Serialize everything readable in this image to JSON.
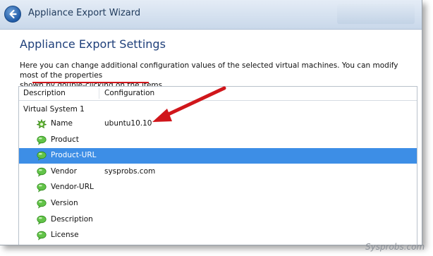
{
  "window": {
    "title": "Appliance Export Wizard"
  },
  "page": {
    "heading": "Appliance Export Settings",
    "description_line1": "Here you can change additional configuration values of the selected virtual machines. You can modify most of the properties",
    "description_line2": "shown by double-clicking on the items."
  },
  "table": {
    "headers": {
      "description": "Description",
      "configuration": "Configuration"
    },
    "group_label": "Virtual System 1",
    "rows": [
      {
        "label": "Name",
        "value": "ubuntu10.10",
        "icon": "gear-star-icon",
        "selected": false
      },
      {
        "label": "Product",
        "value": "",
        "icon": "speech-bubble-icon",
        "selected": false
      },
      {
        "label": "Product-URL",
        "value": "",
        "icon": "speech-bubble-icon",
        "selected": true
      },
      {
        "label": "Vendor",
        "value": "sysprobs.com",
        "icon": "speech-bubble-icon",
        "selected": false
      },
      {
        "label": "Vendor-URL",
        "value": "",
        "icon": "speech-bubble-icon",
        "selected": false
      },
      {
        "label": "Version",
        "value": "",
        "icon": "speech-bubble-icon",
        "selected": false
      },
      {
        "label": "Description",
        "value": "",
        "icon": "speech-bubble-icon",
        "selected": false
      },
      {
        "label": "License",
        "value": "",
        "icon": "speech-bubble-icon",
        "selected": false
      }
    ]
  },
  "watermark": "Sysprobs.com",
  "colors": {
    "selection": "#3d8ee6",
    "annotation_red": "#d0161b",
    "heading_blue": "#1e3f7a"
  }
}
